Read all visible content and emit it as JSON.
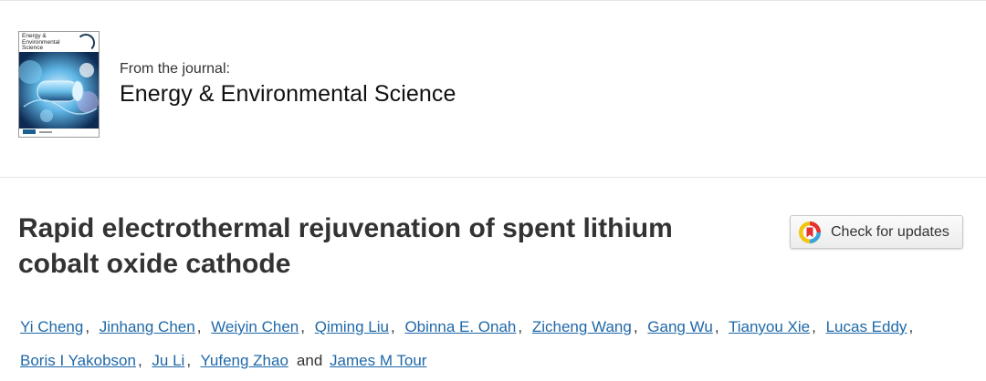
{
  "journal": {
    "from_label": "From the journal:",
    "name": "Energy & Environmental Science",
    "cover_title": "Energy &\nEnvironmental\nScience"
  },
  "article": {
    "title": "Rapid electrothermal rejuvenation of spent lithium cobalt oxide cathode"
  },
  "check_updates": {
    "label": "Check for updates",
    "icon": "crossmark-icon"
  },
  "authors": [
    {
      "name": "Yi Cheng",
      "sep": ","
    },
    {
      "name": "Jinhang Chen",
      "sep": ","
    },
    {
      "name": "Weiyin Chen",
      "sep": ","
    },
    {
      "name": "Qiming Liu",
      "sep": ","
    },
    {
      "name": "Obinna E. Onah",
      "sep": ","
    },
    {
      "name": "Zicheng Wang",
      "sep": ","
    },
    {
      "name": "Gang Wu",
      "sep": ","
    },
    {
      "name": "Tianyou Xie",
      "sep": ","
    },
    {
      "name": "Lucas Eddy",
      "sep": ","
    },
    {
      "name": "Boris I Yakobson",
      "sep": ","
    },
    {
      "name": "Ju Li",
      "sep": ","
    },
    {
      "name": "Yufeng Zhao",
      "sep": "and"
    },
    {
      "name": "James M Tour",
      "sep": ""
    }
  ],
  "colors": {
    "link": "#1f68a8",
    "title": "#333333"
  }
}
